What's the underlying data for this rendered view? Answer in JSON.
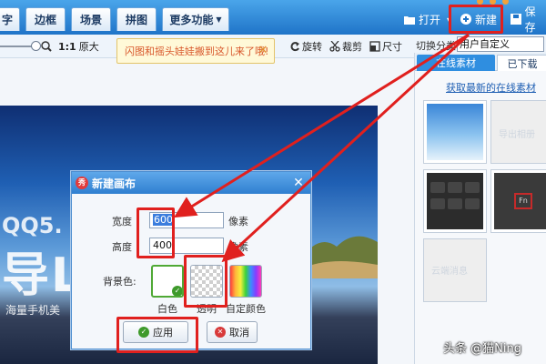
{
  "tabs": [
    {
      "label": "字"
    },
    {
      "label": "边框"
    },
    {
      "label": "场景"
    },
    {
      "label": "拼图"
    },
    {
      "label": "更多功能"
    }
  ],
  "toolbar": {
    "open_label": "打开",
    "new_label": "新建",
    "save_label": "保存"
  },
  "toolbar2": {
    "zoom_ratio": "1:1",
    "original_label": "原大",
    "rotate_label": "旋转",
    "crop_label": "裁剪",
    "size_label": "尺寸"
  },
  "tooltip": {
    "text": "闪图和摇头娃娃搬到这儿来了哦!"
  },
  "category": {
    "label": "切换分类",
    "value": "用户自定义"
  },
  "panel": {
    "tab_online": "在线素材",
    "tab_downloaded": "已下载",
    "get_latest": "获取最新的在线素材",
    "thumbs": [
      {
        "name": "sky",
        "text": ""
      },
      {
        "name": "export-album",
        "text": "导出相册"
      },
      {
        "name": "keyboard-1",
        "text": ""
      },
      {
        "name": "keyboard-fn",
        "text": "Fn"
      },
      {
        "name": "cloud-msg",
        "text": "云端消息"
      }
    ]
  },
  "photo": {
    "qq_text": "QQ5.",
    "big_text": "导L",
    "small_text": "海量手机美"
  },
  "dialog": {
    "title": "新建画布",
    "width_label": "宽度",
    "width_value": "600",
    "height_label": "高度",
    "height_value": "400",
    "unit": "像素",
    "bg_label": "背景色:",
    "options": [
      {
        "label": "白色"
      },
      {
        "label": "透明"
      },
      {
        "label": "自定颜色"
      }
    ],
    "apply_label": "应用",
    "cancel_label": "取消"
  },
  "watermark": "头条 @猫Ning",
  "colors": {
    "accent": "#2f8ee0",
    "highlight": "#e0201e"
  }
}
